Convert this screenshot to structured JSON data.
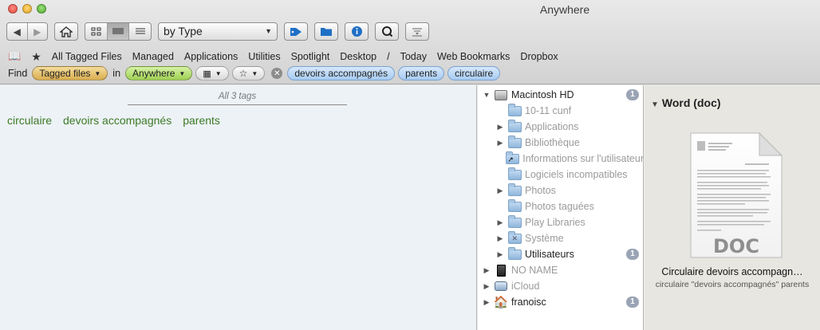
{
  "window": {
    "title": "Anywhere"
  },
  "toolbar": {
    "sort_popup": "by Type"
  },
  "favorites": [
    "All Tagged Files",
    "Managed",
    "Applications",
    "Utilities",
    "Spotlight",
    "Desktop",
    "/",
    "Today",
    "Web Bookmarks",
    "Dropbox"
  ],
  "find": {
    "label": "Find",
    "scope_label": "Tagged files",
    "in_label": "in",
    "location_label": "Anywhere",
    "tokens": [
      "devoirs accompagnés",
      "parents",
      "circulaire"
    ]
  },
  "tags_panel": {
    "header": "All 3 tags",
    "tags": [
      "circulaire",
      "devoirs accompagnés",
      "parents"
    ]
  },
  "tree": {
    "rows": [
      {
        "label": "Macintosh HD",
        "indent": 0,
        "triangle": "open",
        "icon": "disk-icon",
        "dim": false,
        "badge": "1"
      },
      {
        "label": "10-11 cunf",
        "indent": 1,
        "triangle": "",
        "icon": "folder-icon",
        "dim": true,
        "badge": ""
      },
      {
        "label": "Applications",
        "indent": 1,
        "triangle": "closed",
        "icon": "folder-icon",
        "dim": true,
        "badge": ""
      },
      {
        "label": "Bibliothèque",
        "indent": 1,
        "triangle": "closed",
        "icon": "folder-icon",
        "dim": true,
        "badge": ""
      },
      {
        "label": "Informations sur l'utilisateur",
        "indent": 1,
        "triangle": "",
        "icon": "alias-folder-icon",
        "dim": true,
        "badge": ""
      },
      {
        "label": "Logiciels incompatibles",
        "indent": 1,
        "triangle": "",
        "icon": "folder-icon",
        "dim": true,
        "badge": ""
      },
      {
        "label": "Photos",
        "indent": 1,
        "triangle": "closed",
        "icon": "folder-icon",
        "dim": true,
        "badge": ""
      },
      {
        "label": "Photos taguées",
        "indent": 1,
        "triangle": "",
        "icon": "folder-icon",
        "dim": true,
        "badge": ""
      },
      {
        "label": "Play Libraries",
        "indent": 1,
        "triangle": "closed",
        "icon": "folder-icon",
        "dim": true,
        "badge": ""
      },
      {
        "label": "Système",
        "indent": 1,
        "triangle": "closed",
        "icon": "system-folder-icon",
        "dim": true,
        "badge": ""
      },
      {
        "label": "Utilisateurs",
        "indent": 1,
        "triangle": "closed",
        "icon": "folder-icon",
        "dim": false,
        "badge": "1"
      },
      {
        "label": "NO NAME",
        "indent": 0,
        "triangle": "closed",
        "icon": "sd-card-icon",
        "dim": true,
        "badge": ""
      },
      {
        "label": "iCloud",
        "indent": 0,
        "triangle": "closed",
        "icon": "cloud-drive-icon",
        "dim": true,
        "badge": ""
      },
      {
        "label": "franoisc",
        "indent": 0,
        "triangle": "closed",
        "icon": "home-icon",
        "dim": false,
        "badge": "1"
      }
    ]
  },
  "preview": {
    "group_title": "Word (doc)",
    "doc_badge": "DOC",
    "file_name": "Circulaire devoirs accompagn…",
    "file_tags": "circulaire \"devoirs accompagnés\" parents"
  }
}
